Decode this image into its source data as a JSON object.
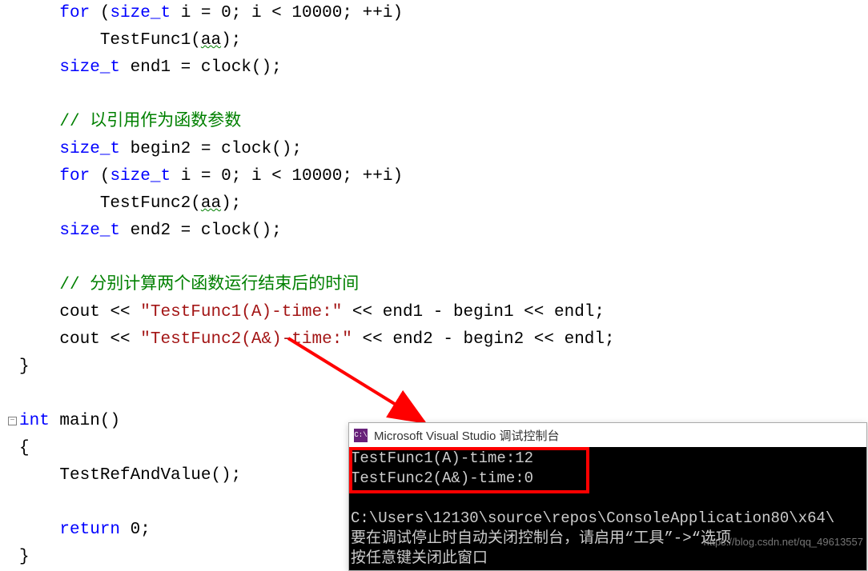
{
  "code": {
    "l1": {
      "kw1": "for",
      "type": "size_t",
      "var": "i",
      "eq": "= ",
      "num1": "0",
      "sep": "; ",
      "var2": "i",
      "cmp": " < ",
      "num2": "10000",
      "sep2": "; ",
      "inc": "++",
      "var3": "i",
      "close": ")"
    },
    "l2": {
      "fn": "TestFunc1",
      "open": "(",
      "arg": "aa",
      "close": ");"
    },
    "l3": {
      "type": "size_t",
      "var": "end1",
      "eq": " = ",
      "fn": "clock",
      "rest": "();"
    },
    "l5": {
      "cmt": "// 以引用作为函数参数"
    },
    "l6": {
      "type": "size_t",
      "var": "begin2",
      "eq": " = ",
      "fn": "clock",
      "rest": "();"
    },
    "l7": {
      "kw1": "for",
      "type": "size_t",
      "var": "i",
      "eq": "= ",
      "num1": "0",
      "sep": "; ",
      "var2": "i",
      "cmp": " < ",
      "num2": "10000",
      "sep2": "; ",
      "inc": "++",
      "var3": "i",
      "close": ")"
    },
    "l8": {
      "fn": "TestFunc2",
      "open": "(",
      "arg": "aa",
      "close": ");"
    },
    "l9": {
      "type": "size_t",
      "var": "end2",
      "eq": " = ",
      "fn": "clock",
      "rest": "();"
    },
    "l11": {
      "cmt": "// 分别计算两个函数运行结束后的时间"
    },
    "l12": {
      "obj": "cout",
      "op1": " << ",
      "str": "\"TestFunc1(A)-time:\"",
      "op2": " << ",
      "ex": "end1 - begin1",
      "op3": " << ",
      "endl": "endl",
      "semi": ";"
    },
    "l13": {
      "obj": "cout",
      "op1": " << ",
      "str": "\"TestFunc2(A&)-time:\"",
      "op2": " << ",
      "ex": "end2 - begin2",
      "op3": " << ",
      "endl": "endl",
      "semi": ";"
    },
    "l14": {
      "brace": "}"
    },
    "l16": {
      "type": "int",
      "fn": "main",
      "rest": "()"
    },
    "l17": {
      "brace": "{"
    },
    "l18": {
      "call": "TestRefAndValue",
      "rest": "();"
    },
    "l20": {
      "kw": "return",
      "val": " 0;"
    },
    "l21": {
      "brace": "}"
    }
  },
  "console": {
    "icon_label": "C:\\",
    "title": "Microsoft Visual Studio 调试控制台",
    "out1": "TestFunc1(A)-time:12",
    "out2": "TestFunc2(A&)-time:0",
    "out3": "",
    "out4": "C:\\Users\\12130\\source\\repos\\ConsoleApplication80\\x64\\",
    "out5": "要在调试停止时自动关闭控制台，请启用“工具”->“选项",
    "out6": "按任意键关闭此窗口"
  },
  "watermark": "https://blog.csdn.net/qq_49613557"
}
